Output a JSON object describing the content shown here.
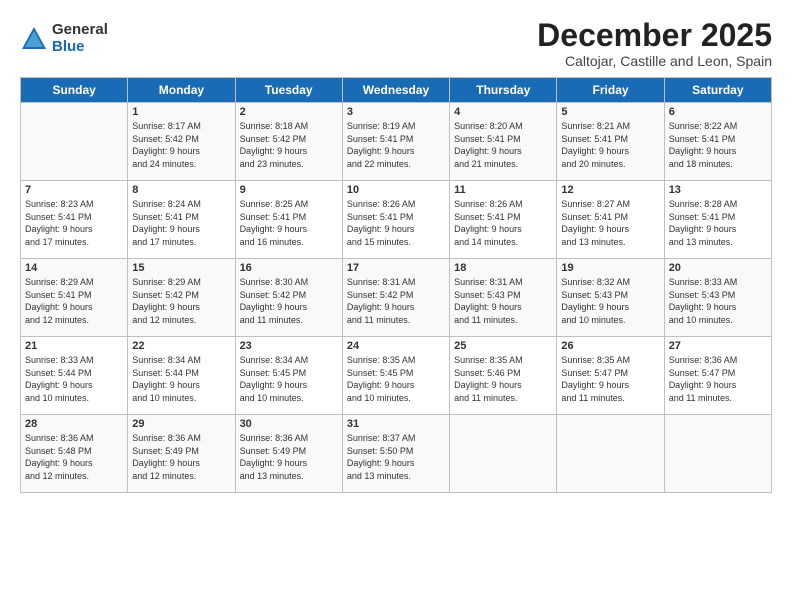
{
  "logo": {
    "general": "General",
    "blue": "Blue"
  },
  "title": "December 2025",
  "subtitle": "Caltojar, Castille and Leon, Spain",
  "headers": [
    "Sunday",
    "Monday",
    "Tuesday",
    "Wednesday",
    "Thursday",
    "Friday",
    "Saturday"
  ],
  "weeks": [
    [
      {
        "day": "",
        "info": ""
      },
      {
        "day": "1",
        "info": "Sunrise: 8:17 AM\nSunset: 5:42 PM\nDaylight: 9 hours\nand 24 minutes."
      },
      {
        "day": "2",
        "info": "Sunrise: 8:18 AM\nSunset: 5:42 PM\nDaylight: 9 hours\nand 23 minutes."
      },
      {
        "day": "3",
        "info": "Sunrise: 8:19 AM\nSunset: 5:41 PM\nDaylight: 9 hours\nand 22 minutes."
      },
      {
        "day": "4",
        "info": "Sunrise: 8:20 AM\nSunset: 5:41 PM\nDaylight: 9 hours\nand 21 minutes."
      },
      {
        "day": "5",
        "info": "Sunrise: 8:21 AM\nSunset: 5:41 PM\nDaylight: 9 hours\nand 20 minutes."
      },
      {
        "day": "6",
        "info": "Sunrise: 8:22 AM\nSunset: 5:41 PM\nDaylight: 9 hours\nand 18 minutes."
      }
    ],
    [
      {
        "day": "7",
        "info": "Sunrise: 8:23 AM\nSunset: 5:41 PM\nDaylight: 9 hours\nand 17 minutes."
      },
      {
        "day": "8",
        "info": "Sunrise: 8:24 AM\nSunset: 5:41 PM\nDaylight: 9 hours\nand 17 minutes."
      },
      {
        "day": "9",
        "info": "Sunrise: 8:25 AM\nSunset: 5:41 PM\nDaylight: 9 hours\nand 16 minutes."
      },
      {
        "day": "10",
        "info": "Sunrise: 8:26 AM\nSunset: 5:41 PM\nDaylight: 9 hours\nand 15 minutes."
      },
      {
        "day": "11",
        "info": "Sunrise: 8:26 AM\nSunset: 5:41 PM\nDaylight: 9 hours\nand 14 minutes."
      },
      {
        "day": "12",
        "info": "Sunrise: 8:27 AM\nSunset: 5:41 PM\nDaylight: 9 hours\nand 13 minutes."
      },
      {
        "day": "13",
        "info": "Sunrise: 8:28 AM\nSunset: 5:41 PM\nDaylight: 9 hours\nand 13 minutes."
      }
    ],
    [
      {
        "day": "14",
        "info": "Sunrise: 8:29 AM\nSunset: 5:41 PM\nDaylight: 9 hours\nand 12 minutes."
      },
      {
        "day": "15",
        "info": "Sunrise: 8:29 AM\nSunset: 5:42 PM\nDaylight: 9 hours\nand 12 minutes."
      },
      {
        "day": "16",
        "info": "Sunrise: 8:30 AM\nSunset: 5:42 PM\nDaylight: 9 hours\nand 11 minutes."
      },
      {
        "day": "17",
        "info": "Sunrise: 8:31 AM\nSunset: 5:42 PM\nDaylight: 9 hours\nand 11 minutes."
      },
      {
        "day": "18",
        "info": "Sunrise: 8:31 AM\nSunset: 5:43 PM\nDaylight: 9 hours\nand 11 minutes."
      },
      {
        "day": "19",
        "info": "Sunrise: 8:32 AM\nSunset: 5:43 PM\nDaylight: 9 hours\nand 10 minutes."
      },
      {
        "day": "20",
        "info": "Sunrise: 8:33 AM\nSunset: 5:43 PM\nDaylight: 9 hours\nand 10 minutes."
      }
    ],
    [
      {
        "day": "21",
        "info": "Sunrise: 8:33 AM\nSunset: 5:44 PM\nDaylight: 9 hours\nand 10 minutes."
      },
      {
        "day": "22",
        "info": "Sunrise: 8:34 AM\nSunset: 5:44 PM\nDaylight: 9 hours\nand 10 minutes."
      },
      {
        "day": "23",
        "info": "Sunrise: 8:34 AM\nSunset: 5:45 PM\nDaylight: 9 hours\nand 10 minutes."
      },
      {
        "day": "24",
        "info": "Sunrise: 8:35 AM\nSunset: 5:45 PM\nDaylight: 9 hours\nand 10 minutes."
      },
      {
        "day": "25",
        "info": "Sunrise: 8:35 AM\nSunset: 5:46 PM\nDaylight: 9 hours\nand 11 minutes."
      },
      {
        "day": "26",
        "info": "Sunrise: 8:35 AM\nSunset: 5:47 PM\nDaylight: 9 hours\nand 11 minutes."
      },
      {
        "day": "27",
        "info": "Sunrise: 8:36 AM\nSunset: 5:47 PM\nDaylight: 9 hours\nand 11 minutes."
      }
    ],
    [
      {
        "day": "28",
        "info": "Sunrise: 8:36 AM\nSunset: 5:48 PM\nDaylight: 9 hours\nand 12 minutes."
      },
      {
        "day": "29",
        "info": "Sunrise: 8:36 AM\nSunset: 5:49 PM\nDaylight: 9 hours\nand 12 minutes."
      },
      {
        "day": "30",
        "info": "Sunrise: 8:36 AM\nSunset: 5:49 PM\nDaylight: 9 hours\nand 13 minutes."
      },
      {
        "day": "31",
        "info": "Sunrise: 8:37 AM\nSunset: 5:50 PM\nDaylight: 9 hours\nand 13 minutes."
      },
      {
        "day": "",
        "info": ""
      },
      {
        "day": "",
        "info": ""
      },
      {
        "day": "",
        "info": ""
      }
    ]
  ]
}
